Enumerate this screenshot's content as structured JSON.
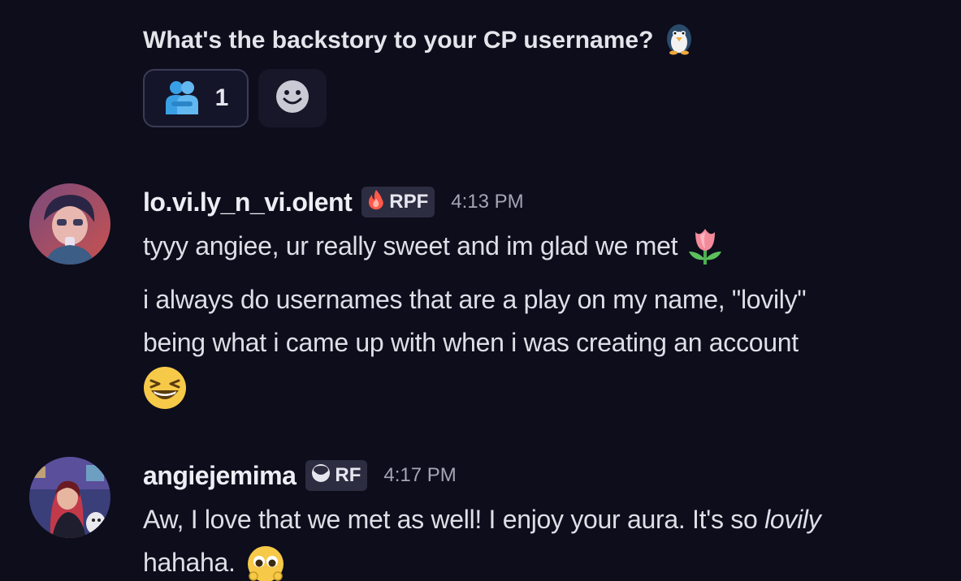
{
  "previous_message": {
    "text": "What's the backstory to your CP username?",
    "emoji": "penguin-emoji",
    "reactions": [
      {
        "emoji": "people-hugging-emoji",
        "count": "1"
      }
    ],
    "add_reaction_icon": "smiley-add-reaction-icon"
  },
  "messages": [
    {
      "username": "lo.vi.ly_n_vi.olent",
      "tag": {
        "icon": "fire-icon",
        "label": "RPF"
      },
      "time": "4:13 PM",
      "lines": [
        "tyyy angiee, ur really sweet and im glad we met",
        "i always do usernames that are a play on my name, \"lovily\"",
        "being what i came up with when i was creating an account"
      ],
      "emojis": [
        "tulip-emoji",
        "laughing-emoji"
      ]
    },
    {
      "username": "angiejemima",
      "tag": {
        "icon": "moon-icon",
        "label": "RF"
      },
      "time": "4:17 PM",
      "line_start": "Aw, I love that we met as well! I enjoy your aura. It's so ",
      "line_italic": "lovily",
      "line2": "hahaha.",
      "emojis": [
        "shy-face-emoji"
      ]
    }
  ],
  "colors": {
    "background": "#0d0d1c",
    "text": "#dedfe6",
    "timestamp": "#a3a6b4",
    "tag_bg": "#2c2d40"
  }
}
